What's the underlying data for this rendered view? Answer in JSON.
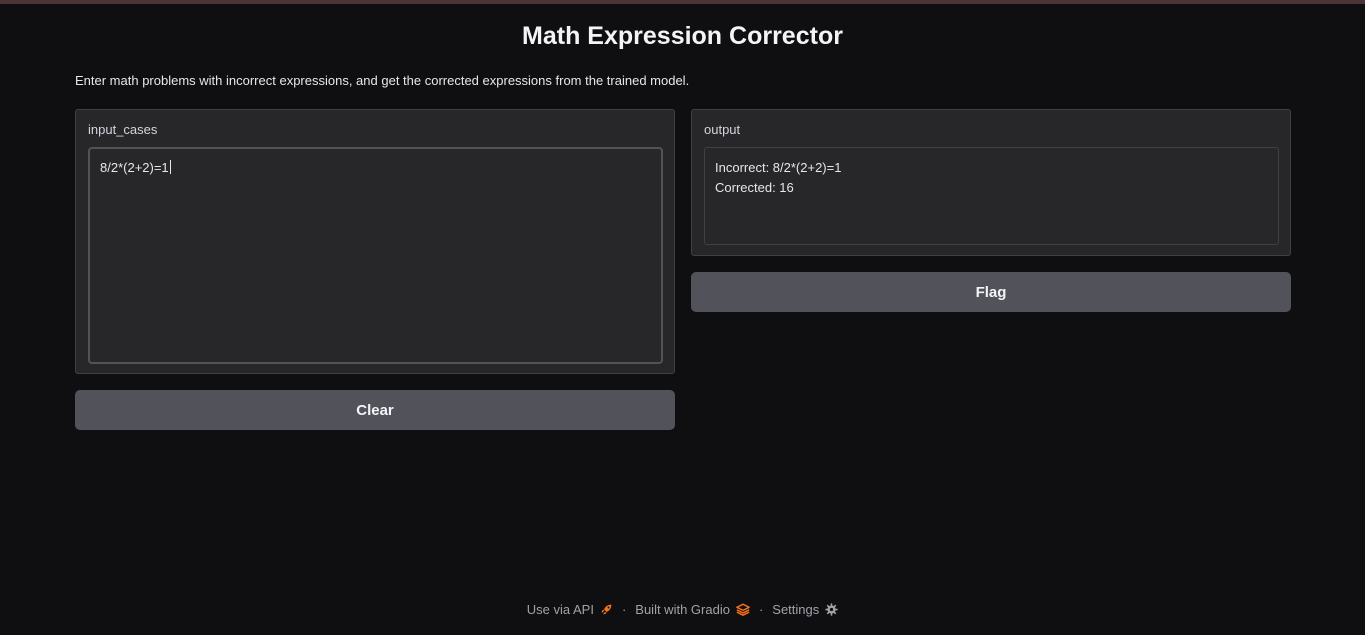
{
  "app": {
    "title": "Math Expression Corrector",
    "description": "Enter math problems with incorrect expressions, and get the corrected expressions from the trained model."
  },
  "input": {
    "label": "input_cases",
    "value": "8/2*(2+2)=1"
  },
  "output": {
    "label": "output",
    "line1": "Incorrect: 8/2*(2+2)=1",
    "line2": "Corrected: 16"
  },
  "buttons": {
    "clear_label": "Clear",
    "flag_label": "Flag"
  },
  "footer": {
    "api_label": "Use via API",
    "api_icon": "rocket-icon",
    "built_label": "Built with Gradio",
    "built_icon": "gradio-logo-icon",
    "settings_label": "Settings",
    "settings_icon": "gear-icon",
    "separator": "·"
  },
  "colors": {
    "background": "#0f0f11",
    "panel": "#27272a",
    "button": "#52525b",
    "accent": "#f97316"
  }
}
